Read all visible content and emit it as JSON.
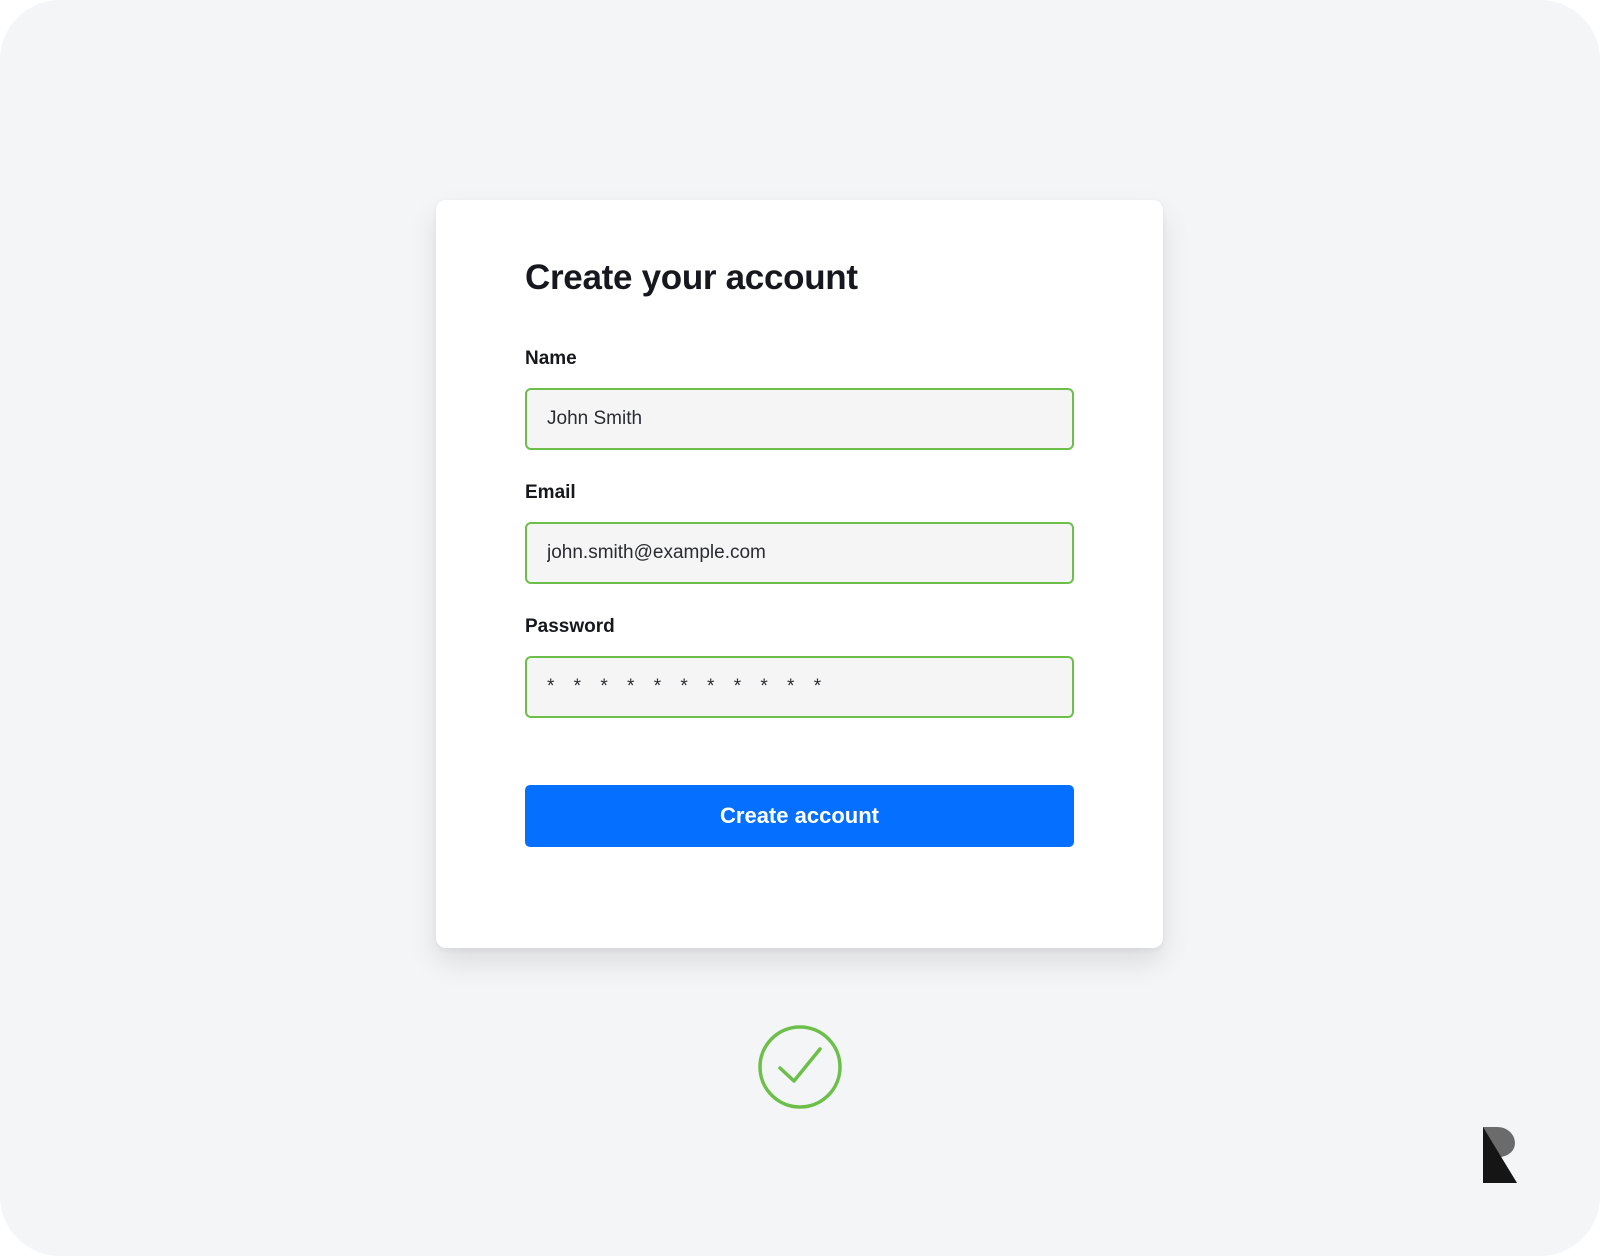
{
  "form": {
    "title": "Create your account",
    "fields": [
      {
        "label": "Name",
        "value": "John Smith"
      },
      {
        "label": "Email",
        "value": "john.smith@example.com"
      },
      {
        "label": "Password",
        "value": "* * * * * * * * * * *"
      }
    ],
    "submit_label": "Create account"
  },
  "status": {
    "icon": "check-circle-icon",
    "color": "#6cc04a"
  },
  "brand": {
    "icon": "brand-logo-icon"
  },
  "colors": {
    "accent": "#0570ff",
    "valid_border": "#6cc04a",
    "background": "#f4f5f7",
    "card": "#ffffff"
  }
}
